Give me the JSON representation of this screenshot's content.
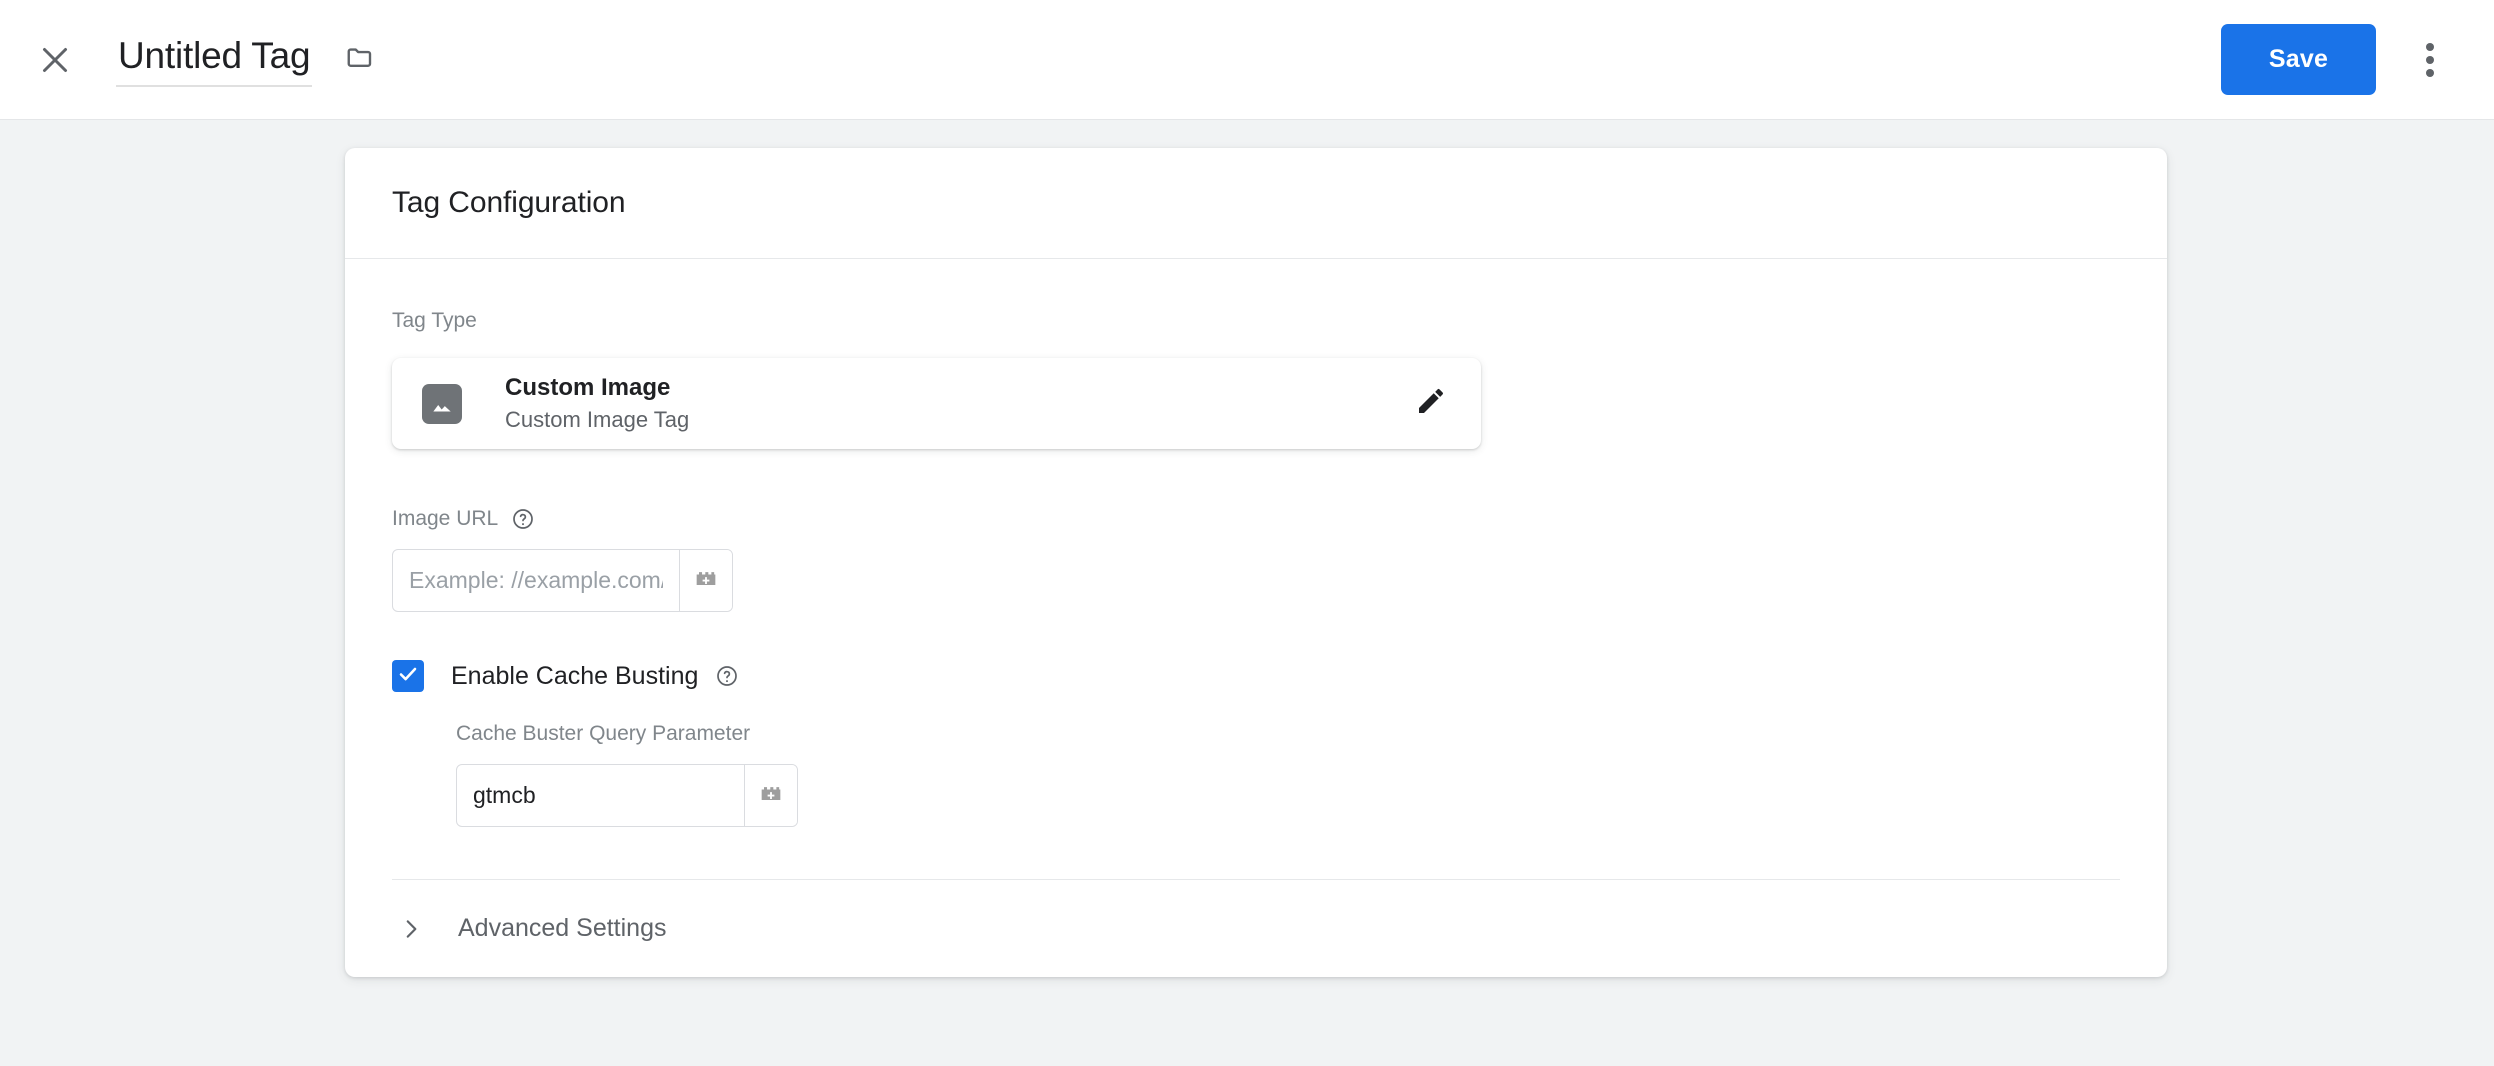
{
  "appbar": {
    "close_icon": "close-icon",
    "title": "Untitled Tag",
    "folder_icon": "folder-icon",
    "save_label": "Save",
    "more_icon": "more-vert-icon"
  },
  "card": {
    "header_title": "Tag Configuration",
    "tag_type": {
      "label": "Tag Type",
      "icon": "image-icon",
      "name": "Custom Image",
      "description": "Custom Image Tag",
      "edit_icon": "pencil-icon"
    },
    "image_url": {
      "label": "Image URL",
      "help_icon": "help-circle-icon",
      "value": "",
      "placeholder": "Example: //example.com/a.gif",
      "variable_icon": "variable-brick-icon"
    },
    "cache_busting": {
      "checked": true,
      "label": "Enable Cache Busting",
      "help_icon": "help-circle-icon",
      "param_label": "Cache Buster Query Parameter",
      "param_value": "gtmcb",
      "param_placeholder": "",
      "variable_icon": "variable-brick-icon"
    },
    "advanced": {
      "chevron_icon": "chevron-right-icon",
      "label": "Advanced Settings"
    }
  },
  "colors": {
    "accent": "#1a73e8",
    "page_bg": "#f1f3f4",
    "text_primary": "#202124",
    "text_secondary": "#5f6368",
    "text_muted": "#80868b",
    "border": "#dadce0"
  }
}
